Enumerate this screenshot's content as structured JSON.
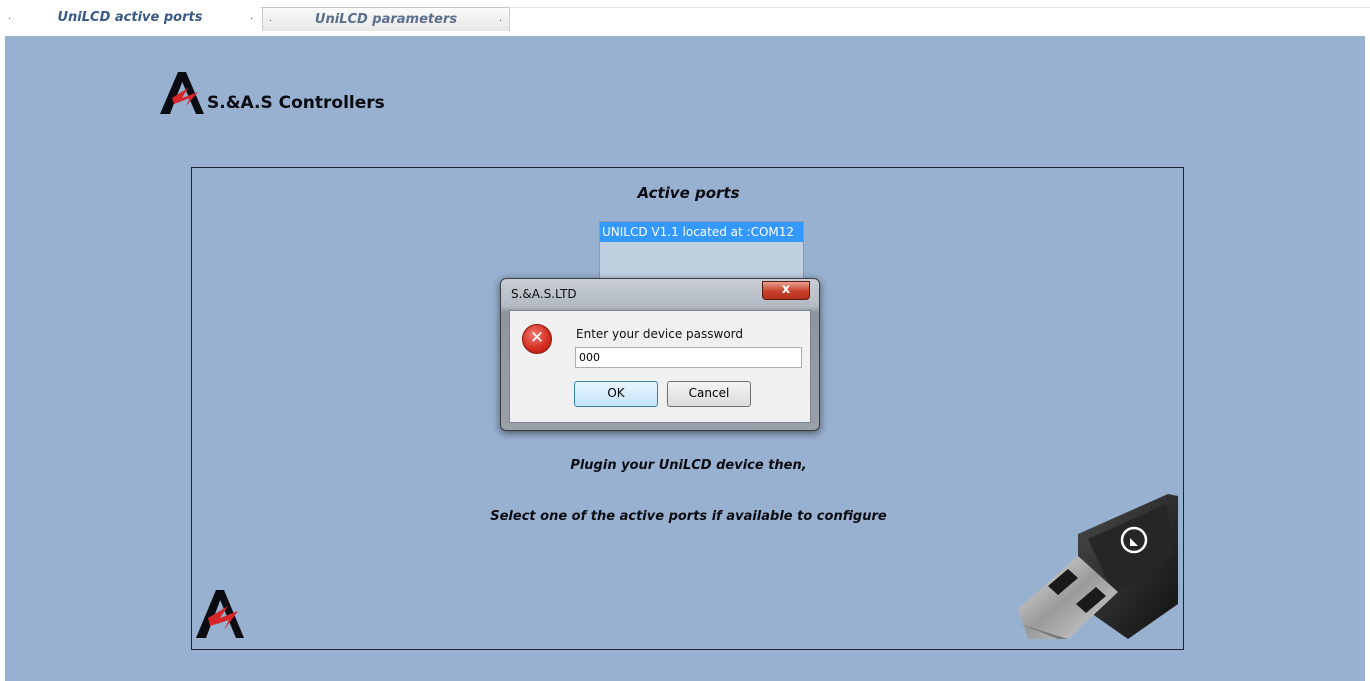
{
  "tabs": [
    {
      "label": "UniLCD active ports",
      "active": true
    },
    {
      "label": "UniLCD parameters",
      "active": false
    }
  ],
  "brand": {
    "name": "S.&A.S Controllers"
  },
  "panel": {
    "title": "Active ports",
    "ports": [
      "UNILCD V1.1 located at :COM12"
    ],
    "message_1": "Plugin your UniLCD device then,",
    "message_2": "Select one of the active ports if available  to configure"
  },
  "dialog": {
    "title": "S.&A.S.LTD",
    "close_label": "x",
    "prompt": "Enter your device password",
    "password_value": "000",
    "ok_label": "OK",
    "cancel_label": "Cancel"
  },
  "colors": {
    "background": "#98b1d0",
    "selection": "#3399ff",
    "logo_red": "#d8252a"
  },
  "icons": [
    "company-logo-icon",
    "error-icon",
    "usb-plug-icon"
  ]
}
